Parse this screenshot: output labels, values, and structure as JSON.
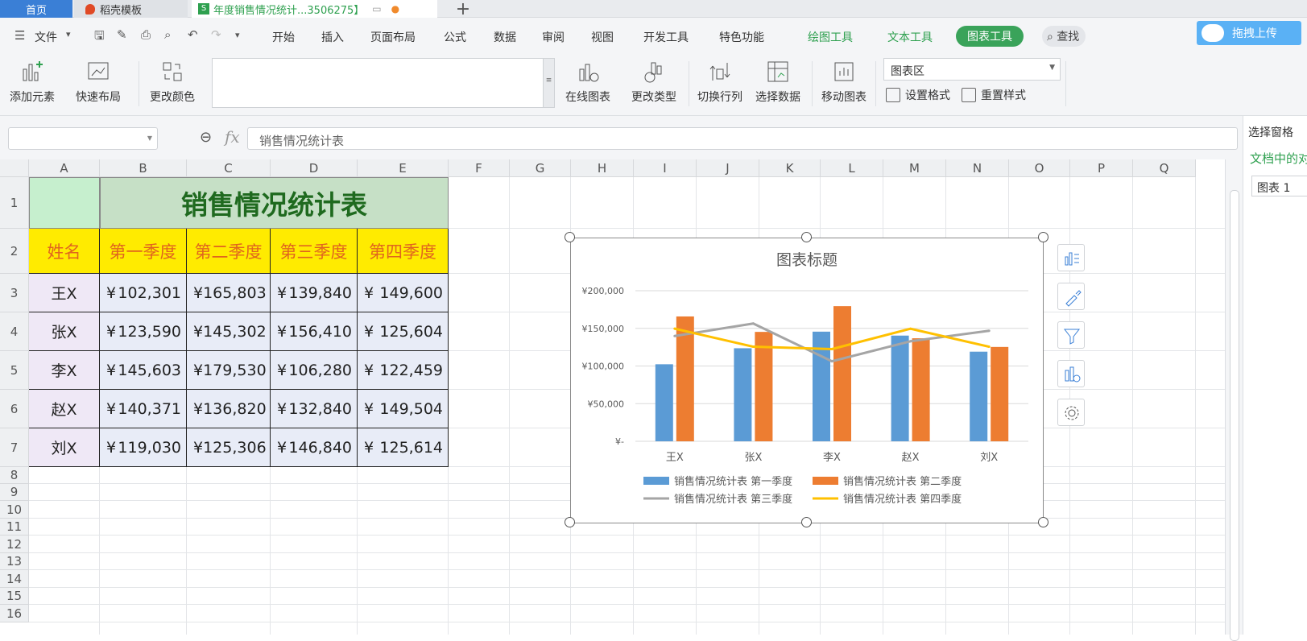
{
  "tabs": {
    "home": "首页",
    "template": "稻壳模板",
    "document": "年度销售情况统计...3506275】"
  },
  "menu": {
    "file": "文件",
    "items": [
      "开始",
      "插入",
      "页面布局",
      "公式",
      "数据",
      "审阅",
      "视图",
      "开发工具",
      "特色功能"
    ],
    "drawing_tools": "绘图工具",
    "text_tools": "文本工具",
    "chart_tools": "图表工具",
    "search": "查找",
    "upload": "拖拽上传"
  },
  "ribbon": {
    "add_element": "添加元素",
    "quick_layout": "快速布局",
    "change_color": "更改颜色",
    "online_chart": "在线图表",
    "change_type": "更改类型",
    "switch_rowcol": "切换行列",
    "select_data": "选择数据",
    "move_chart": "移动图表",
    "chart_area": "图表区",
    "set_format": "设置格式",
    "reset_style": "重置样式"
  },
  "formula_bar": {
    "namebox": "",
    "fx": "fx",
    "content": "销售情况统计表"
  },
  "side_panel": {
    "title": "选择窗格",
    "subtitle": "文档中的对",
    "item": "图表 1"
  },
  "columns": [
    "A",
    "B",
    "C",
    "D",
    "E",
    "F",
    "G",
    "H",
    "I",
    "J",
    "K",
    "L",
    "M",
    "N",
    "O",
    "P",
    "Q"
  ],
  "rows": [
    "1",
    "2",
    "3",
    "4",
    "5",
    "6",
    "7",
    "8",
    "9",
    "10",
    "11",
    "12",
    "13",
    "14",
    "15",
    "16"
  ],
  "sheet": {
    "title": "销售情况统计表",
    "headers": [
      "姓名",
      "第一季度",
      "第二季度",
      "第三季度",
      "第四季度"
    ],
    "currency": "¥",
    "records": [
      {
        "name": "王X",
        "q": [
          "102,301",
          "165,803",
          "139,840",
          "149,600"
        ]
      },
      {
        "name": "张X",
        "q": [
          "123,590",
          "145,302",
          "156,410",
          "125,604"
        ]
      },
      {
        "name": "李X",
        "q": [
          "145,603",
          "179,530",
          "106,280",
          "122,459"
        ]
      },
      {
        "name": "赵X",
        "q": [
          "140,371",
          "136,820",
          "132,840",
          "149,504"
        ]
      },
      {
        "name": "刘X",
        "q": [
          "119,030",
          "125,306",
          "146,840",
          "125,614"
        ]
      }
    ]
  },
  "chart_data": {
    "type": "bar",
    "title": "图表标题",
    "categories": [
      "王X",
      "张X",
      "李X",
      "赵X",
      "刘X"
    ],
    "yticks": [
      "¥-",
      "¥50,000",
      "¥100,000",
      "¥150,000",
      "¥200,000"
    ],
    "ylim": [
      0,
      200000
    ],
    "series": [
      {
        "name": "销售情况统计表 第一季度",
        "kind": "bar",
        "color": "#5b9bd5",
        "values": [
          102301,
          123590,
          145603,
          140371,
          119030
        ]
      },
      {
        "name": "销售情况统计表 第二季度",
        "kind": "bar",
        "color": "#ed7d31",
        "values": [
          165803,
          145302,
          179530,
          136820,
          125306
        ]
      },
      {
        "name": "销售情况统计表 第三季度",
        "kind": "line",
        "color": "#a5a5a5",
        "values": [
          139840,
          156410,
          106280,
          132840,
          146840
        ]
      },
      {
        "name": "销售情况统计表 第四季度",
        "kind": "line",
        "color": "#ffc000",
        "values": [
          149600,
          125604,
          122459,
          149504,
          125614
        ]
      }
    ],
    "legend": "bottom",
    "grid": true
  }
}
